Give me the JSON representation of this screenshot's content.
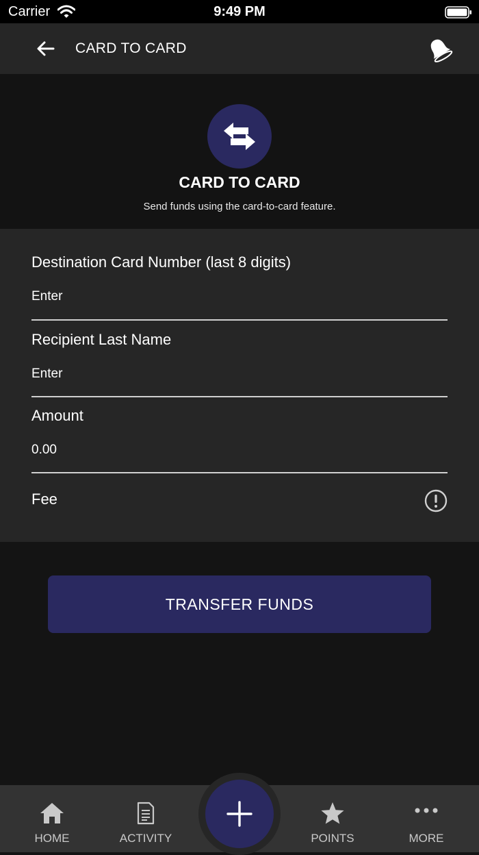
{
  "status_bar": {
    "carrier": "Carrier",
    "time": "9:49 PM"
  },
  "header": {
    "title": "CARD TO CARD",
    "back_icon": "arrow-left-icon",
    "notification_icon": "bell-icon"
  },
  "hero": {
    "icon": "swap-arrows-icon",
    "title": "CARD TO CARD",
    "subtitle": "Send funds using the card-to-card feature."
  },
  "form": {
    "destination_card": {
      "label": "Destination Card Number (last 8 digits)",
      "placeholder": "Enter",
      "value": ""
    },
    "recipient_last_name": {
      "label": "Recipient Last Name",
      "placeholder": "Enter",
      "value": ""
    },
    "amount": {
      "label": "Amount",
      "placeholder": "0.00",
      "value": ""
    },
    "fee": {
      "label": "Fee",
      "icon": "info-icon"
    }
  },
  "actions": {
    "transfer_label": "TRANSFER FUNDS"
  },
  "tab_bar": {
    "items": [
      {
        "label": "HOME",
        "icon": "home-icon"
      },
      {
        "label": "ACTIVITY",
        "icon": "document-icon"
      },
      {
        "label": "POINTS",
        "icon": "star-icon"
      },
      {
        "label": "MORE",
        "icon": "more-dots-icon"
      }
    ],
    "fab_icon": "plus-icon"
  },
  "colors": {
    "accent": "#2a2960",
    "nav_background": "#262626",
    "page_background": "#141414"
  }
}
